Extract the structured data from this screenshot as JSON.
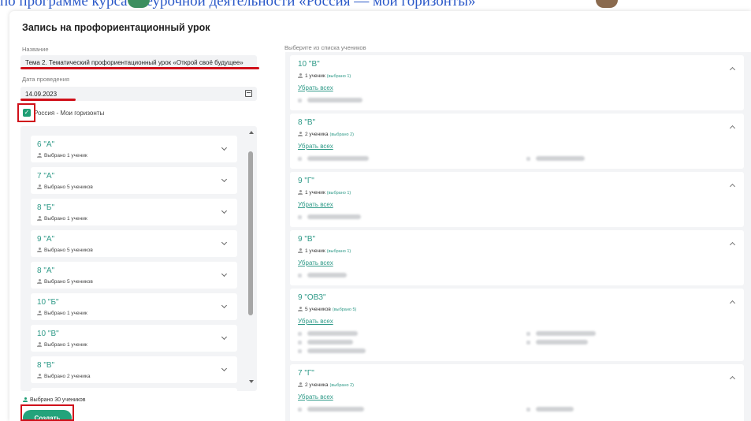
{
  "background_doc": {
    "text": "по программе курса внеурочной деятельности «Россия — мои горизонты»"
  },
  "modal": {
    "title": "Запись на профориентационный урок"
  },
  "form": {
    "name_label": "Название",
    "name_value": "Тема 2. Тематический профориентационный урок «Открой своё будущее»",
    "date_label": "Дата проведения",
    "date_value": "14.09.2023",
    "checkbox_checked": true,
    "checkbox_label": "Россия - Мои горизонты"
  },
  "class_list": [
    {
      "name": "6 \"А\"",
      "selected": "Выбрано 1 ученик"
    },
    {
      "name": "7 \"А\"",
      "selected": "Выбрано 5 учеников"
    },
    {
      "name": "8 \"Б\"",
      "selected": "Выбрано 1 ученик"
    },
    {
      "name": "9 \"А\"",
      "selected": "Выбрано 5 учеников"
    },
    {
      "name": "8 \"А\"",
      "selected": "Выбрано 5 учеников"
    },
    {
      "name": "10 \"Б\"",
      "selected": "Выбрано 1 ученик"
    },
    {
      "name": "10 \"В\"",
      "selected": "Выбрано 1 ученик"
    },
    {
      "name": "8 \"В\"",
      "selected": "Выбрано 2 ученика"
    }
  ],
  "footer": {
    "total_selected": "Выбрано 30 учеников",
    "create_label": "Создать"
  },
  "students_panel": {
    "label": "Выберите из списка учеников",
    "remove_all_label": "Убрать всех",
    "groups": [
      {
        "name": "10 \"В\"",
        "count": "1 ученик",
        "selected": "(выбрано 1)"
      },
      {
        "name": "8 \"В\"",
        "count": "2 ученика",
        "selected": "(выбрано 2)"
      },
      {
        "name": "9 \"Г\"",
        "count": "1 ученик",
        "selected": "(выбрано 1)"
      },
      {
        "name": "9 \"В\"",
        "count": "1 ученик",
        "selected": "(выбрано 1)"
      },
      {
        "name": "9 \"ОВЗ\"",
        "count": "5 учеников",
        "selected": "(выбрано 5)"
      },
      {
        "name": "7 \"Г\"",
        "count": "2 ученика",
        "selected": "(выбрано 2)"
      }
    ]
  },
  "colors": {
    "accent": "#23a37b",
    "class_text": "#2f9a88",
    "highlight": "#d0101a"
  }
}
